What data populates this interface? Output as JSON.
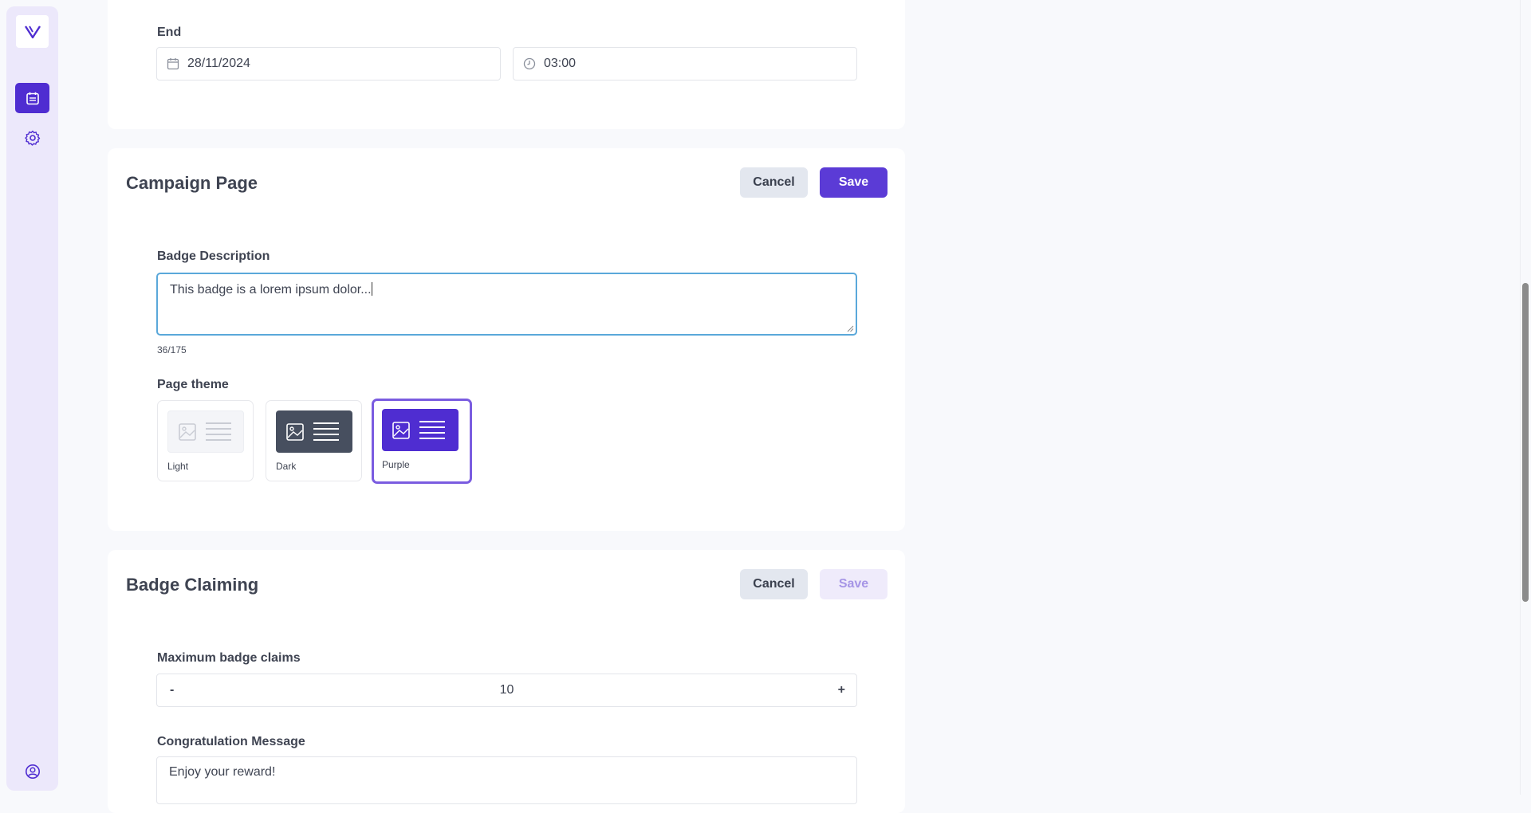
{
  "end_section": {
    "label": "End",
    "date_value": "28/11/2024",
    "time_value": "03:00"
  },
  "campaign_page": {
    "title": "Campaign Page",
    "cancel_label": "Cancel",
    "save_label": "Save",
    "badge_description_label": "Badge Description",
    "badge_description_value": "This badge is a lorem ipsum dolor...",
    "char_counter": "36/175",
    "page_theme_label": "Page theme",
    "themes": [
      {
        "label": "Light",
        "selected": false
      },
      {
        "label": "Dark",
        "selected": false
      },
      {
        "label": "Purple",
        "selected": true
      }
    ]
  },
  "badge_claiming": {
    "title": "Badge Claiming",
    "cancel_label": "Cancel",
    "save_label": "Save",
    "max_claims_label": "Maximum badge claims",
    "max_claims_value": "10",
    "decrement_label": "-",
    "increment_label": "+",
    "congrats_label": "Congratulation Message",
    "congrats_value": "Enjoy your reward!"
  },
  "colors": {
    "accent": "#4f2dd1",
    "sidebar_bg": "#ece8fb",
    "focus_border": "#5aa8da",
    "theme_dark": "#474f5f",
    "theme_purple": "#4f2dd1"
  }
}
